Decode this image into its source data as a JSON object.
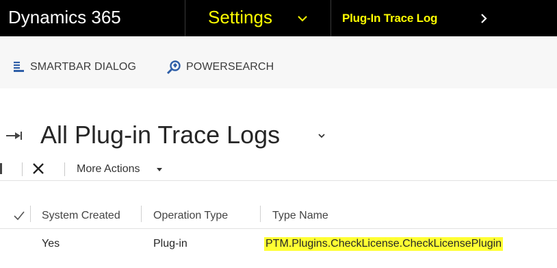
{
  "topbar": {
    "app_title": "Dynamics 365",
    "area_label": "Settings",
    "entity_label": "Plug-In Trace Log"
  },
  "command_bar": {
    "smartbar_label": "SMARTBAR DIALOG",
    "powersearch_label": "POWERSEARCH"
  },
  "view": {
    "title": "All Plug-in Trace Logs"
  },
  "grid_commands": {
    "more_actions_label": "More Actions"
  },
  "grid": {
    "columns": [
      "System Created",
      "Operation Type",
      "Type Name"
    ],
    "rows": [
      {
        "system_created": "Yes",
        "operation_type": "Plug-in",
        "type_name": "PTM.Plugins.CheckLicense.CheckLicensePlugin"
      }
    ]
  },
  "colors": {
    "topbar_bg": "#000000",
    "accent_text": "#ffff00",
    "highlight": "#ffff33",
    "command_bar_bg": "#f7f7f7"
  }
}
